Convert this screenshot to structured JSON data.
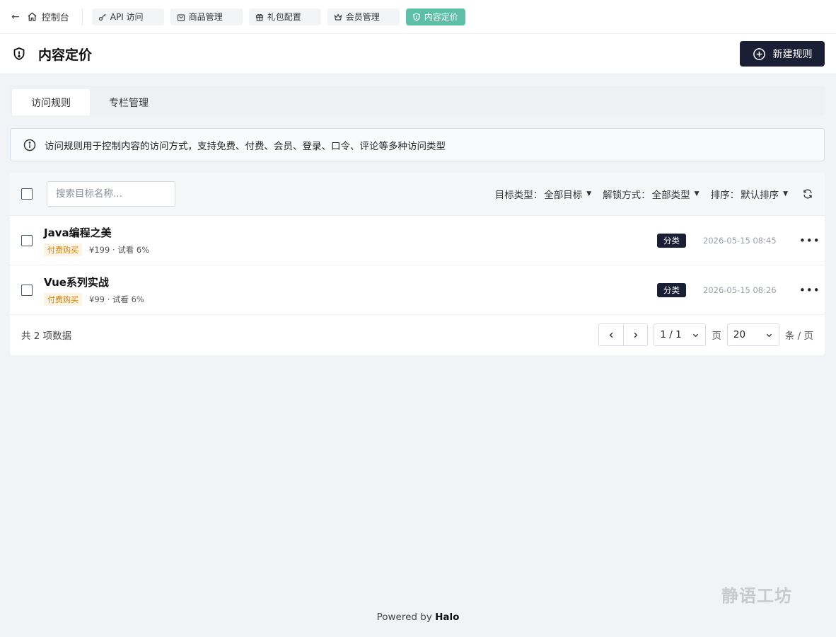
{
  "topbar": {
    "back_label": "控制台",
    "tabs": [
      {
        "label": "API 访问",
        "icon": "key-icon"
      },
      {
        "label": "商品管理",
        "icon": "bag-icon"
      },
      {
        "label": "礼包配置",
        "icon": "gift-icon"
      },
      {
        "label": "会员管理",
        "icon": "crown-icon"
      },
      {
        "label": "内容定价",
        "icon": "shield-icon",
        "active": true
      }
    ]
  },
  "header": {
    "title": "内容定价",
    "icon": "shield-icon",
    "new_button_label": "新建规则"
  },
  "subtabs": [
    {
      "label": "访问规则",
      "active": true
    },
    {
      "label": "专栏管理",
      "active": false
    }
  ],
  "notice": {
    "text": "访问规则用于控制内容的访问方式，支持免费、付费、会员、登录、口令、评论等多种访问类型"
  },
  "toolbar": {
    "search_placeholder": "搜索目标名称...",
    "filters": [
      {
        "label": "目标类型：",
        "value": "全部目标"
      },
      {
        "label": "解锁方式：",
        "value": "全部类型"
      },
      {
        "label": "排序：",
        "value": "默认排序"
      }
    ]
  },
  "rows": [
    {
      "title": "Java编程之美",
      "tag": "付费购买",
      "meta": "¥199 · 试看 6%",
      "badge": "分类",
      "date": "2026-05-15 08:45"
    },
    {
      "title": "Vue系列实战",
      "tag": "付费购买",
      "meta": "¥99 · 试看 6%",
      "badge": "分类",
      "date": "2026-05-15 08:26"
    }
  ],
  "pagination": {
    "total_text": "共 2 项数据",
    "page_value": "1 / 1",
    "page_unit": "页",
    "size_value": "20",
    "size_unit": "条 / 页"
  },
  "footer": {
    "powered_prefix": "Powered by",
    "powered_brand": "Halo",
    "watermark": "静语工坊"
  },
  "colors": {
    "accent": "#5dbfa6",
    "primary_dark": "#1a1f36",
    "paid_tag_text": "#c98615",
    "page_bg": "#f1f3f7"
  }
}
